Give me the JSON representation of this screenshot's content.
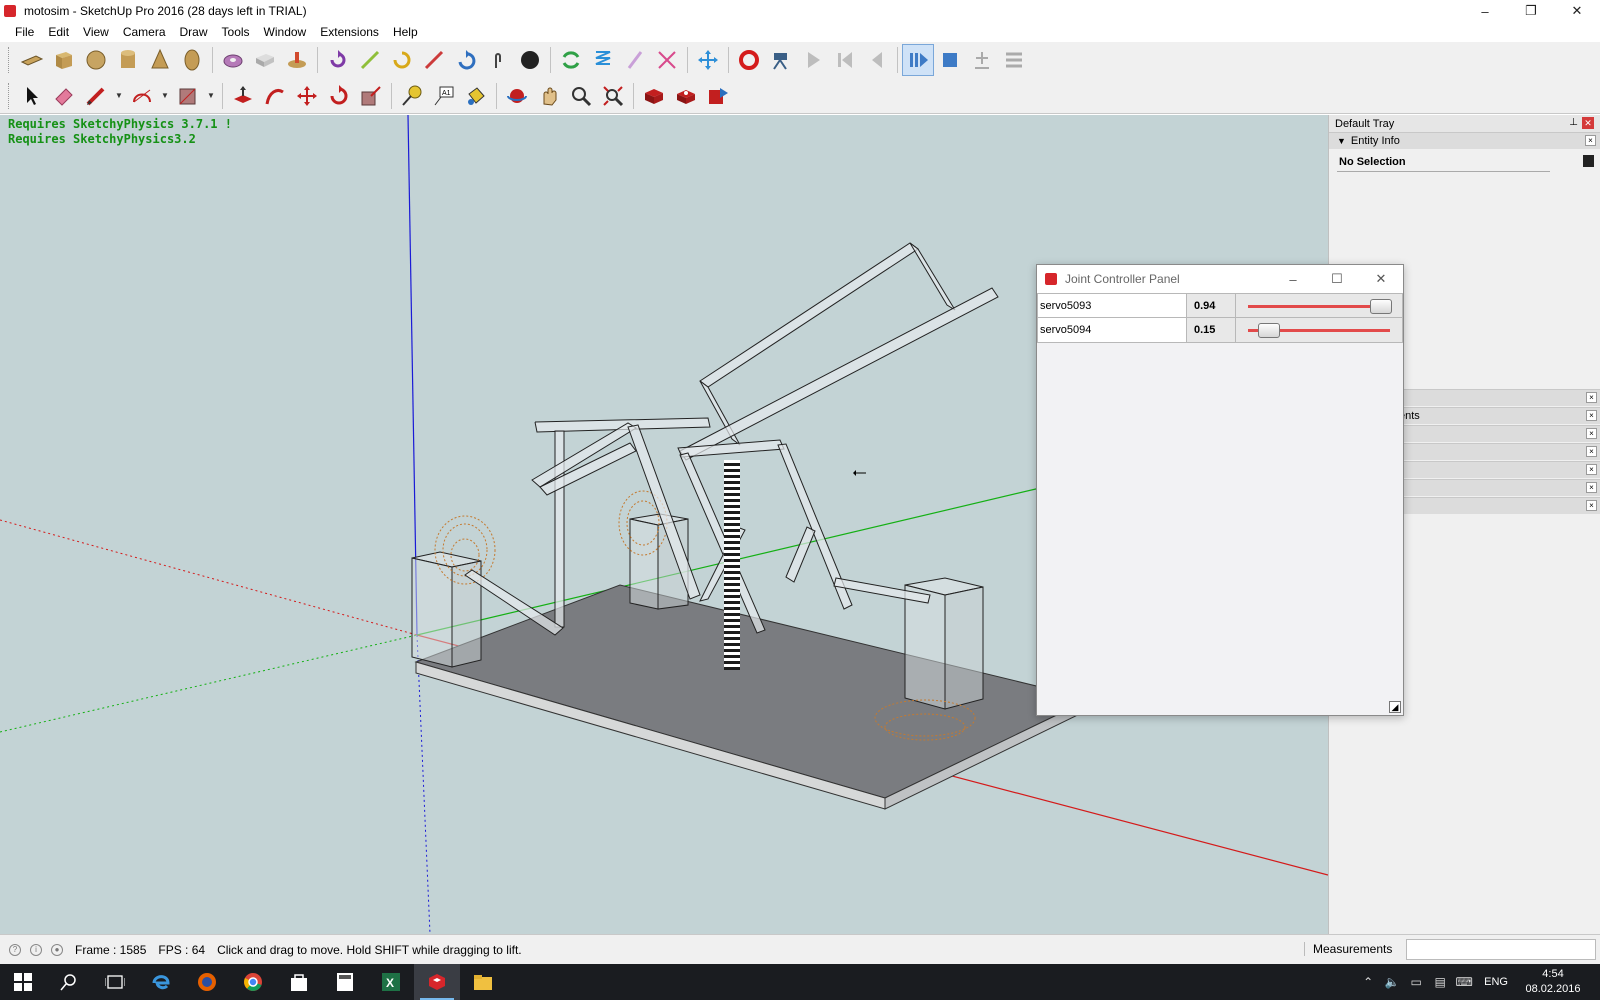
{
  "window": {
    "title": "motosim - SketchUp Pro 2016 (28 days left in TRIAL)",
    "minimize": "–",
    "maximize": "❐",
    "close": "✕"
  },
  "menu": [
    "File",
    "Edit",
    "View",
    "Camera",
    "Draw",
    "Tools",
    "Window",
    "Extensions",
    "Help"
  ],
  "viewport": {
    "messages": [
      "Requires SketchyPhysics 3.7.1 !",
      "Requires SketchyPhysics3.2"
    ],
    "background": "#c3d3d5"
  },
  "tray": {
    "title": "Default Tray",
    "pin": "📌",
    "close": "✕",
    "entity_info": {
      "label": "Entity Info",
      "arrow": "▼",
      "selection": "No Selection"
    },
    "partial_panel_label": "ents"
  },
  "joint_panel": {
    "title": "Joint Controller Panel",
    "minimize": "–",
    "maximize": "☐",
    "close": "✕",
    "sliders": [
      {
        "name": "servo5093",
        "value_text": "0.94",
        "value": 0.94
      },
      {
        "name": "servo5094",
        "value_text": "0.15",
        "value": 0.15
      }
    ],
    "accent": "#e24a4a"
  },
  "status": {
    "frame": "Frame : 1585",
    "fps": "FPS : 64",
    "hint": "Click and drag to move. Hold SHIFT while dragging to lift.",
    "measurements_label": "Measurements"
  },
  "taskbar": {
    "lang": "ENG",
    "time": "4:54",
    "date": "08.02.2016"
  }
}
